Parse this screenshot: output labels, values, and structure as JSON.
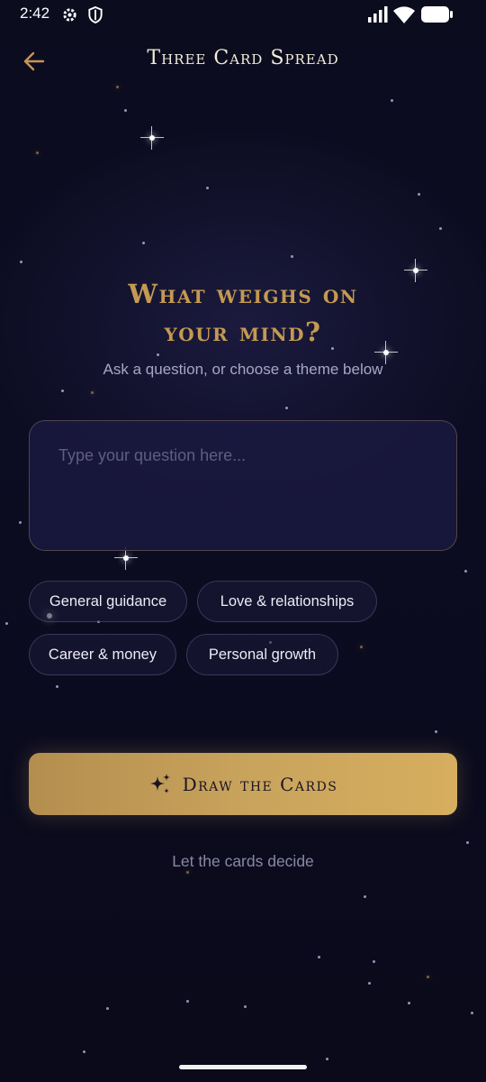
{
  "status_bar": {
    "time": "2:42",
    "left_icons": [
      "gear-icon",
      "shield-icon"
    ],
    "right_icons": [
      "signal-icon",
      "wifi-icon",
      "battery-icon"
    ]
  },
  "header": {
    "title": "Three Card Spread",
    "back_icon": "arrow-left-icon"
  },
  "prompt": {
    "headline_line1": "What weighs on",
    "headline_line2": "your mind?",
    "subtitle": "Ask a question, or choose a theme below"
  },
  "question_input": {
    "value": "",
    "placeholder": "Type your question here..."
  },
  "themes": [
    {
      "label": "General guidance"
    },
    {
      "label": "Love & relationships"
    },
    {
      "label": "Career & money"
    },
    {
      "label": "Personal growth"
    }
  ],
  "draw_button": {
    "label": "Draw the Cards",
    "icon": "sparkles-icon"
  },
  "secondary_link": "Let the cards decide",
  "colors": {
    "background": "#0b0b1c",
    "accent_gold": "#c49a52",
    "button_gold": "#d7ae5f",
    "input_bg": "#1a1940"
  }
}
